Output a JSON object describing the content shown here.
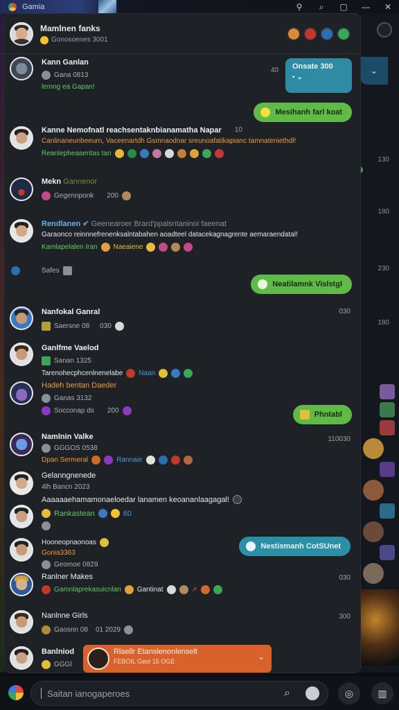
{
  "window": {
    "title": "Gamia"
  },
  "titlebar_buttons": [
    "search-icon",
    "minimize-icon",
    "restore-icon",
    "close-icon"
  ],
  "header": {
    "name": "Mamlnen fanks",
    "status": "Gonosoenes 3001"
  },
  "status_card": {
    "title": "Onsate 300",
    "icon": "chevron-down-icon"
  },
  "side_times": [
    "130",
    "180",
    "230",
    "180"
  ],
  "messages": [
    {
      "name": "Kann Ganlan",
      "line1": "Gana 0813",
      "line2": "lemng ea Gapan!",
      "time": "40"
    },
    {
      "bubble": "Mesihanh farl koat",
      "style": "green"
    },
    {
      "name": "Kanne Nemofnatl reachsentaknbianamatha Napar",
      "line1": "Canlinaneunbeeurn, Vaceenartdh Gsmnaodnar sreunoafatikapianc tamnateniethdl!",
      "line2": "Reanlepheaaeritas tan",
      "time": "10"
    },
    {
      "name": "Mekn",
      "name_suffix": "Gannenor",
      "line1": "Gegennponk",
      "line1_value": "200"
    },
    {
      "name": "Rendlanen",
      "name_suffix": "Geenearoer Brard'ppalsntaninoi faeenat",
      "line1": "Garaonco reinnnefrenenksalntabahen aoadteel datacekagnagrente aemaraendatal!",
      "line2": "Kamlapelalen Iran",
      "line2b": "Naeaiene"
    },
    {
      "name": "Safes",
      "line1": ""
    },
    {
      "bubble": "Neatilamnk Vislstgl",
      "style": "green"
    },
    {
      "name": "Nanfokal Ganral",
      "line1": "Saersne 08",
      "line1_value": "030",
      "time": "030"
    },
    {
      "name": "Ganlfme Vaelod",
      "line1": "Sanan 1325",
      "line2": "Tarenohecphcenlnenelabe",
      "line2b": "Naan"
    },
    {
      "name": "Hadeh bentan Daeder",
      "line1": "Ganas 3132",
      "line2": "Socconap ds",
      "line2_value": "200"
    },
    {
      "bubble": "Phntabl",
      "style": "green"
    },
    {
      "name": "Namlnin Valke",
      "line1": "GGGOS 0538",
      "line2": "Dpan Sermeral",
      "line2b": "Rannaie",
      "time": "110030"
    },
    {
      "name": "Gelanngnenede",
      "line1": "4lh Bancn 2023",
      "line2": "Aaaaaaehamamonaeloedar lanamen keoananlaagagal!"
    },
    {
      "name": "Rankastean",
      "line1": ""
    },
    {
      "name": "Hooneopnaonoas",
      "line1": "Gonia3363",
      "line2": "Geomoe 0829"
    },
    {
      "bubble": "Nestismanh CotSUnet",
      "style": "teal"
    },
    {
      "name": "Ranlner Makes",
      "line1": "Gamnlaprekasuicnlan",
      "line1b": "Gantinat",
      "time": "030"
    },
    {
      "name": "Nanlnne Girls",
      "line1": "Gaosnn 08",
      "line1_value": "01 2029",
      "time": "300"
    },
    {
      "name": "Banlniod",
      "line1": "GGGl"
    }
  ],
  "orange_notice": {
    "title": "Rlaellr Etanslenonlenselt",
    "subtitle": "FEBOIL Geol 15 OGE"
  },
  "composer": {
    "placeholder": "Saitan ianogaperoes"
  },
  "colors": {
    "accent_green": "#5fba46",
    "accent_teal": "#2b8fa6",
    "accent_orange": "#d9622a"
  }
}
